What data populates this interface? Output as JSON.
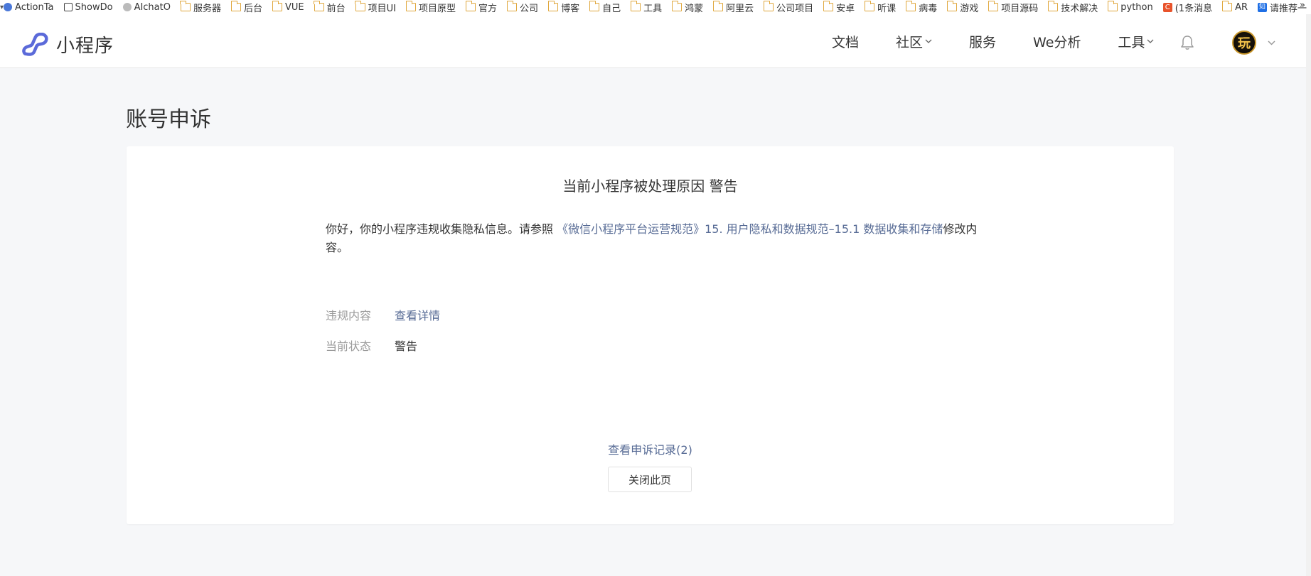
{
  "bookmarks": {
    "items": [
      {
        "label": "ActionTa",
        "icon": "action-icon"
      },
      {
        "label": "ShowDo",
        "icon": "doc-icon"
      },
      {
        "label": "AIchatO",
        "icon": "globe-icon"
      },
      {
        "label": "服务器",
        "icon": "folder-icon"
      },
      {
        "label": "后台",
        "icon": "folder-icon"
      },
      {
        "label": "VUE",
        "icon": "folder-icon"
      },
      {
        "label": "前台",
        "icon": "folder-icon"
      },
      {
        "label": "项目UI",
        "icon": "folder-icon"
      },
      {
        "label": "项目原型",
        "icon": "folder-icon"
      },
      {
        "label": "官方",
        "icon": "folder-icon"
      },
      {
        "label": "公司",
        "icon": "folder-icon"
      },
      {
        "label": "博客",
        "icon": "folder-icon"
      },
      {
        "label": "自己",
        "icon": "folder-icon"
      },
      {
        "label": "工具",
        "icon": "folder-icon"
      },
      {
        "label": "鸿蒙",
        "icon": "folder-icon"
      },
      {
        "label": "阿里云",
        "icon": "folder-icon"
      },
      {
        "label": "公司项目",
        "icon": "folder-icon"
      },
      {
        "label": "安卓",
        "icon": "folder-icon"
      },
      {
        "label": "听课",
        "icon": "folder-icon"
      },
      {
        "label": "病毒",
        "icon": "folder-icon"
      },
      {
        "label": "游戏",
        "icon": "folder-icon"
      },
      {
        "label": "项目源码",
        "icon": "folder-icon"
      },
      {
        "label": "技术解决",
        "icon": "folder-icon"
      },
      {
        "label": "python",
        "icon": "folder-icon"
      },
      {
        "label": "(1条消息",
        "icon": "csdn-icon"
      },
      {
        "label": "AR",
        "icon": "folder-icon"
      },
      {
        "label": "请推荐一",
        "icon": "zhihu-icon"
      }
    ],
    "more": "»"
  },
  "header": {
    "logo_text": "小程序",
    "nav": [
      {
        "label": "文档",
        "has_dropdown": false
      },
      {
        "label": "社区",
        "has_dropdown": true
      },
      {
        "label": "服务",
        "has_dropdown": false
      },
      {
        "label": "We分析",
        "has_dropdown": false
      },
      {
        "label": "工具",
        "has_dropdown": true
      }
    ],
    "avatar_text": "玩"
  },
  "page": {
    "title": "账号申诉"
  },
  "card": {
    "title": "当前小程序被处理原因 警告",
    "notice_prefix": "你好，你的小程序违规收集隐私信息。请参照",
    "notice_link": "《微信小程序平台运营规范》15. 用户隐私和数据规范–15.1 数据收集和存储",
    "notice_suffix": "修改内容。",
    "rows": [
      {
        "label": "违规内容",
        "value": "查看详情",
        "is_link": true
      },
      {
        "label": "当前状态",
        "value": "警告",
        "is_link": false
      }
    ],
    "record_link": "查看申诉记录(2)",
    "close_button": "关闭此页"
  },
  "colors": {
    "brand": "#5b6ad9",
    "link": "#576b95",
    "page_bg": "#f6f7f9"
  }
}
